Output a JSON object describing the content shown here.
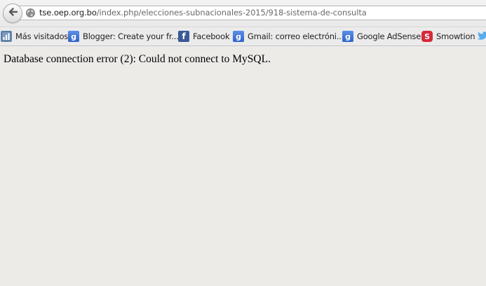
{
  "toolbar": {
    "url_host": "tse.oep.org.bo",
    "url_path": "/index.php/elecciones-subnacionales-2015/918-sistema-de-consulta"
  },
  "bookmarks": [
    {
      "label": "Más visitados",
      "icon": "most-visited-icon"
    },
    {
      "label": "Blogger: Create your fr...",
      "icon": "google-icon"
    },
    {
      "label": "Facebook",
      "icon": "facebook-icon"
    },
    {
      "label": "Gmail: correo electróni...",
      "icon": "google-icon"
    },
    {
      "label": "Google AdSense",
      "icon": "google-icon"
    },
    {
      "label": "Smowtion",
      "icon": "smowtion-icon"
    },
    {
      "label": "",
      "icon": "twitter-icon"
    }
  ],
  "page": {
    "error_message": "Database connection error (2): Could not connect to MySQL."
  },
  "colors": {
    "page_background": "#edebe8",
    "google_icon": "#3b6fd6",
    "facebook_icon": "#3b5998",
    "smowtion_icon": "#d62a3a",
    "twitter_icon": "#55acee"
  }
}
